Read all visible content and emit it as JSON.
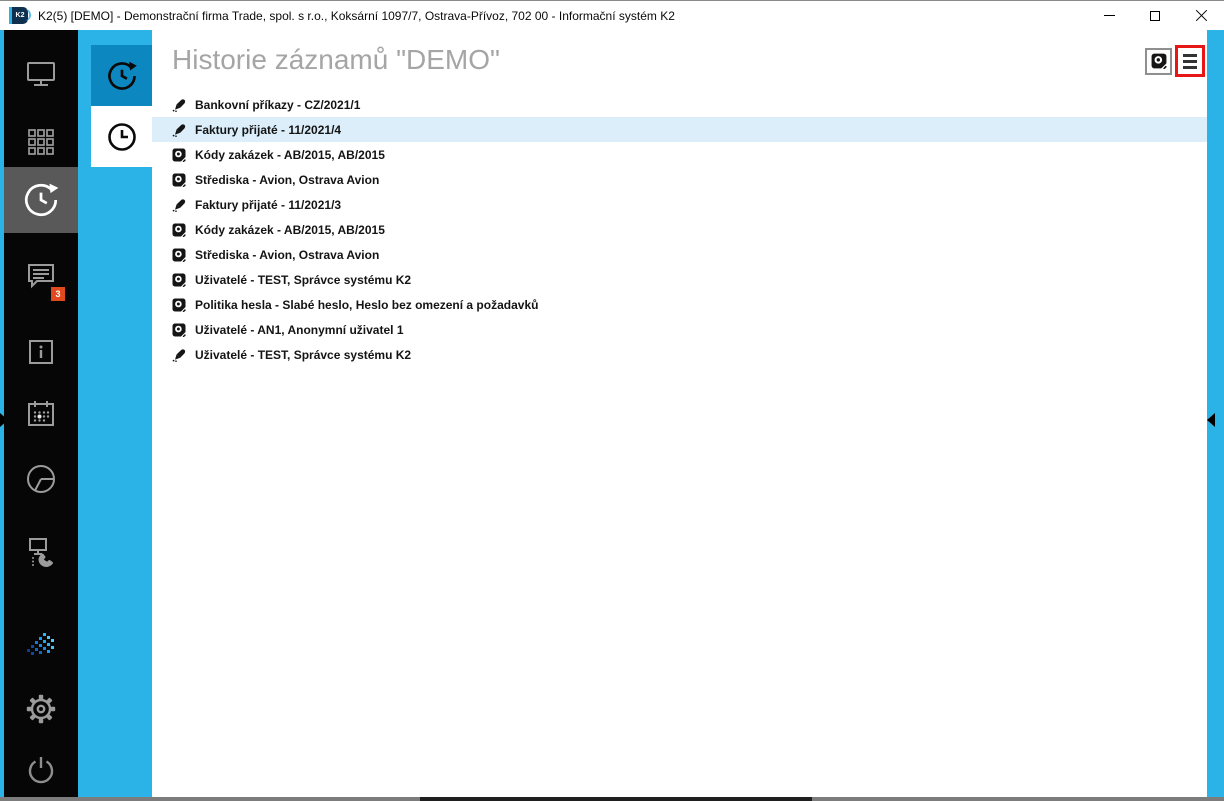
{
  "window": {
    "title": "K2(5) [DEMO] - Demonstrační firma Trade, spol. s r.o., Koksární 1097/7, Ostrava-Přívoz, 702 00 - Informační systém K2",
    "app_badge": "K2",
    "controls": [
      "minimize",
      "maximize",
      "close"
    ]
  },
  "colors": {
    "accent_cyan": "#2bb3e8",
    "active_tile_blue": "#0d87c0",
    "sidebar_black": "#060606",
    "sidebar_active_gray": "#595959",
    "selected_row_blue": "#dbeefa",
    "badge_orange": "#e2491f",
    "highlight_red": "#e81717",
    "title_gray": "#a5a5a5"
  },
  "sidebar": {
    "badge_count": "3",
    "items": [
      {
        "name": "desktop",
        "icon": "monitor-icon"
      },
      {
        "name": "modules",
        "icon": "apps-grid-icon"
      },
      {
        "name": "history",
        "icon": "history-clock-icon",
        "active": true
      },
      {
        "name": "messages",
        "icon": "chat-bubble-icon",
        "badge": "3"
      },
      {
        "name": "information",
        "icon": "info-icon"
      },
      {
        "name": "calendar",
        "icon": "calendar-icon"
      },
      {
        "name": "reports",
        "icon": "pie-chart-icon"
      },
      {
        "name": "phone",
        "icon": "workstation-phone-icon"
      },
      {
        "name": "k2-sparkle",
        "icon": "sparkle-icon"
      },
      {
        "name": "settings",
        "icon": "gear-icon"
      },
      {
        "name": "power",
        "icon": "power-icon"
      }
    ]
  },
  "subsidebar": {
    "items": [
      {
        "name": "record-history",
        "icon": "history-clock-icon",
        "active": true
      },
      {
        "name": "recent",
        "icon": "clock-icon",
        "active": false
      }
    ]
  },
  "main": {
    "title": "Historie záznamů \"DEMO\"",
    "toolbar": {
      "record_button_icon": "record-icon",
      "menu_button_icon": "hamburger-icon",
      "menu_button_highlighted": true
    },
    "records": [
      {
        "icon": "pencil",
        "label": "Bankovní příkazy - CZ/2021/1",
        "selected": false
      },
      {
        "icon": "pencil",
        "label": "Faktury přijaté - 11/2021/4",
        "selected": true
      },
      {
        "icon": "record",
        "label": "Kódy zakázek - AB/2015, AB/2015",
        "selected": false
      },
      {
        "icon": "record",
        "label": "Střediska - Avion, Ostrava Avion",
        "selected": false
      },
      {
        "icon": "pencil",
        "label": "Faktury přijaté - 11/2021/3",
        "selected": false
      },
      {
        "icon": "record",
        "label": "Kódy zakázek - AB/2015, AB/2015",
        "selected": false
      },
      {
        "icon": "record",
        "label": "Střediska - Avion, Ostrava Avion",
        "selected": false
      },
      {
        "icon": "record",
        "label": "Uživatelé - TEST, Správce systému K2",
        "selected": false
      },
      {
        "icon": "record",
        "label": "Politika hesla - Slabé heslo, Heslo bez omezení a požadavků",
        "selected": false
      },
      {
        "icon": "record",
        "label": "Uživatelé - AN1, Anonymní uživatel 1",
        "selected": false
      },
      {
        "icon": "pencil",
        "label": "Uživatelé - TEST, Správce systému K2",
        "selected": false
      }
    ]
  }
}
